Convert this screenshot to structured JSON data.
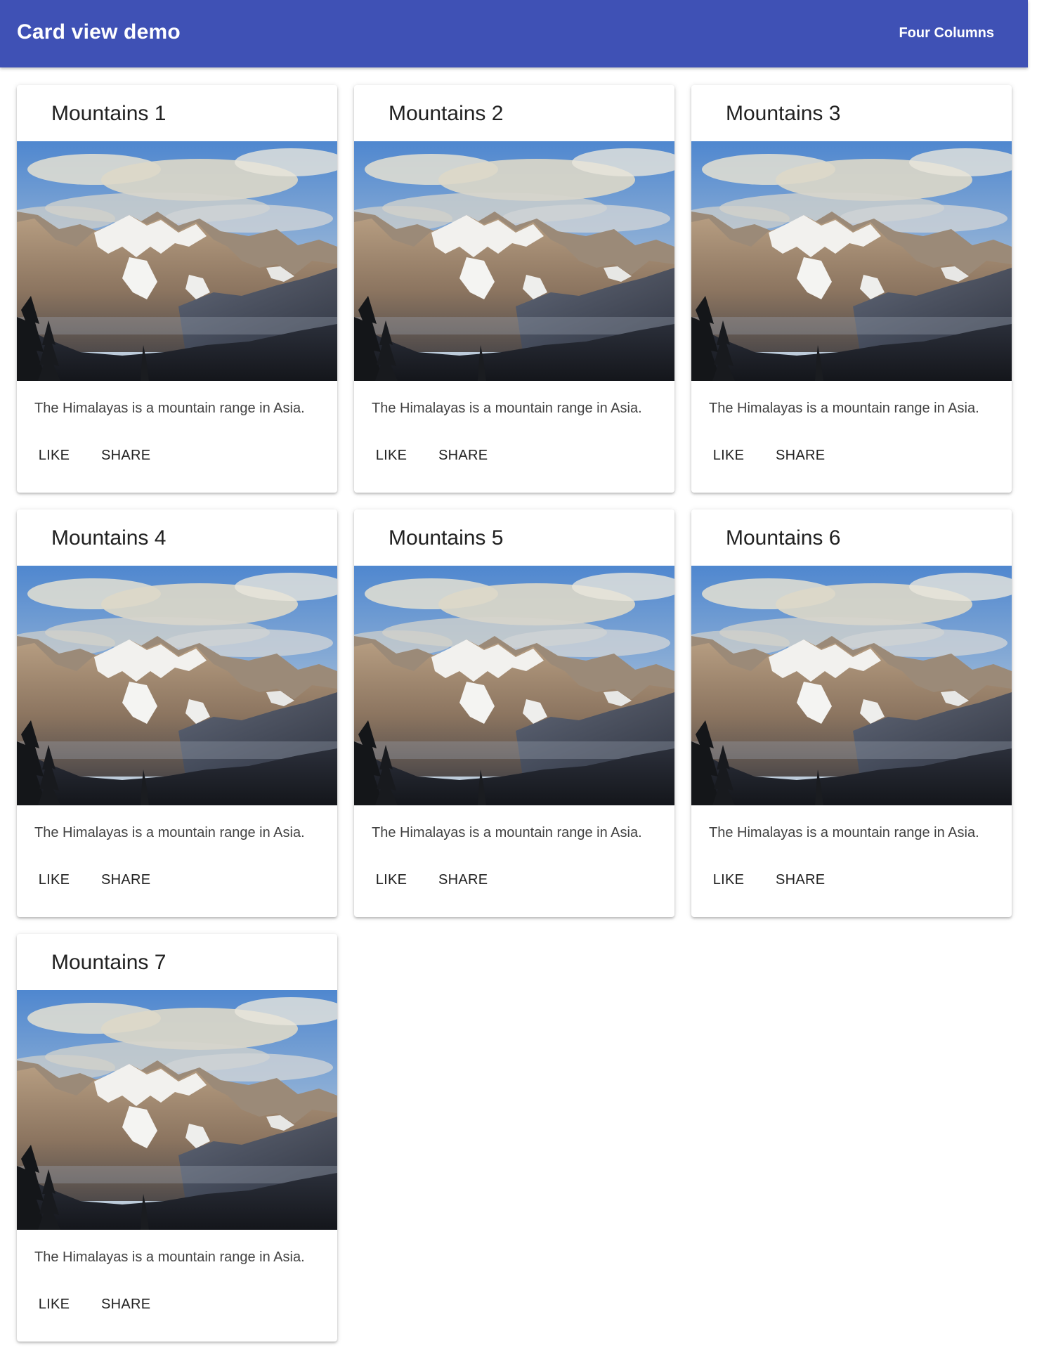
{
  "app_bar": {
    "title": "Card view demo",
    "action_label": "Four Columns",
    "color": "#3f51b5"
  },
  "cards": [
    {
      "title": "Mountains 1",
      "text": "The Himalayas is a mountain range in Asia.",
      "like_label": "LIKE",
      "share_label": "SHARE",
      "image": "mountain-landscape"
    },
    {
      "title": "Mountains 2",
      "text": "The Himalayas is a mountain range in Asia.",
      "like_label": "LIKE",
      "share_label": "SHARE",
      "image": "mountain-landscape"
    },
    {
      "title": "Mountains 3",
      "text": "The Himalayas is a mountain range in Asia.",
      "like_label": "LIKE",
      "share_label": "SHARE",
      "image": "mountain-landscape"
    },
    {
      "title": "Mountains 4",
      "text": "The Himalayas is a mountain range in Asia.",
      "like_label": "LIKE",
      "share_label": "SHARE",
      "image": "mountain-landscape"
    },
    {
      "title": "Mountains 5",
      "text": "The Himalayas is a mountain range in Asia.",
      "like_label": "LIKE",
      "share_label": "SHARE",
      "image": "mountain-landscape"
    },
    {
      "title": "Mountains 6",
      "text": "The Himalayas is a mountain range in Asia.",
      "like_label": "LIKE",
      "share_label": "SHARE",
      "image": "mountain-landscape"
    },
    {
      "title": "Mountains 7",
      "text": "The Himalayas is a mountain range in Asia.",
      "like_label": "LIKE",
      "share_label": "SHARE",
      "image": "mountain-landscape"
    }
  ]
}
